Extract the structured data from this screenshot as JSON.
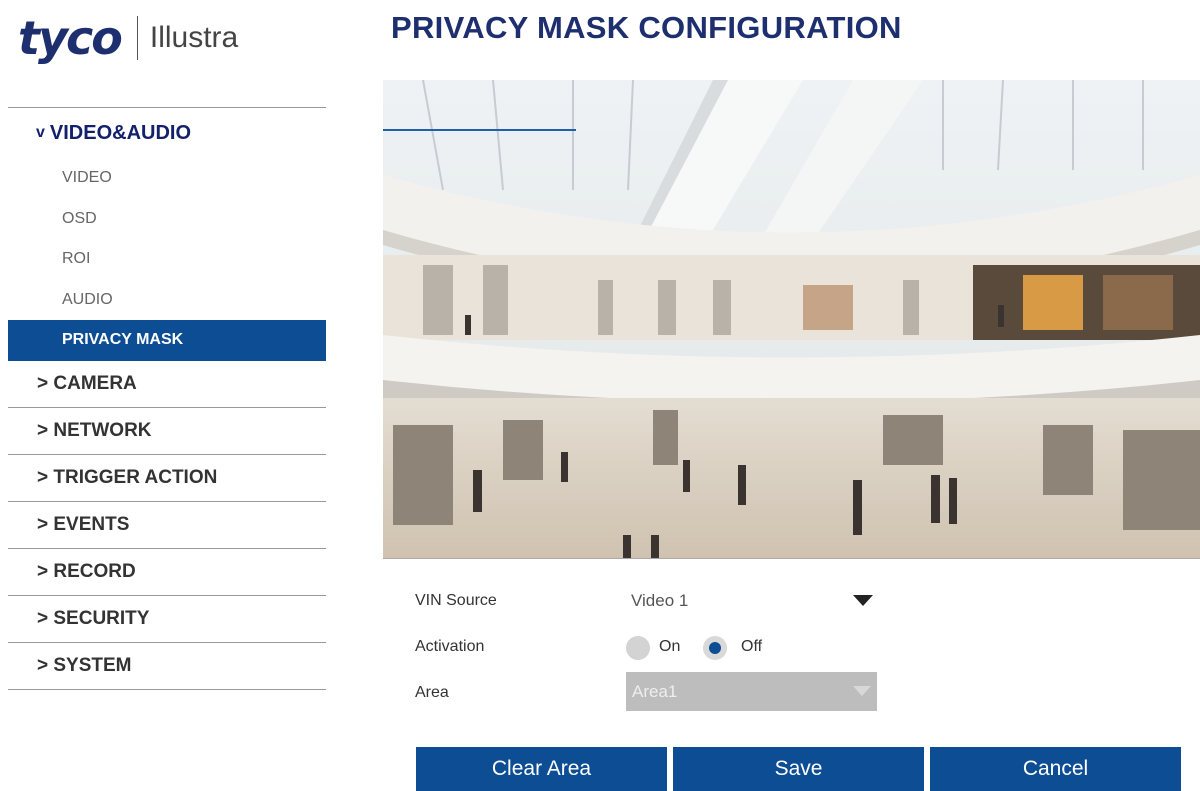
{
  "logo": {
    "brand": "tyco",
    "product": "Illustra"
  },
  "page": {
    "title": "PRIVACY MASK CONFIGURATION"
  },
  "sidebar": {
    "open_section": {
      "chevron": "v",
      "label": "VIDEO&AUDIO"
    },
    "sub_items": [
      {
        "label": "VIDEO",
        "active": false
      },
      {
        "label": "OSD",
        "active": false
      },
      {
        "label": "ROI",
        "active": false
      },
      {
        "label": "AUDIO",
        "active": false
      },
      {
        "label": "PRIVACY MASK",
        "active": true
      }
    ],
    "sections": [
      {
        "label": "> CAMERA"
      },
      {
        "label": "> NETWORK"
      },
      {
        "label": "> TRIGGER ACTION"
      },
      {
        "label": "> EVENTS"
      },
      {
        "label": "> RECORD"
      },
      {
        "label": "> SECURITY"
      },
      {
        "label": "> SYSTEM"
      }
    ]
  },
  "form": {
    "vin_source": {
      "label": "VIN Source",
      "value": "Video 1"
    },
    "activation": {
      "label": "Activation",
      "option_on": "On",
      "option_off": "Off",
      "selected": "Off"
    },
    "area": {
      "label": "Area",
      "value": "Area1",
      "disabled": true
    }
  },
  "buttons": {
    "clear_area": "Clear Area",
    "save": "Save",
    "cancel": "Cancel"
  },
  "colors": {
    "brand_navy": "#1d2f6e",
    "accent_blue": "#0d4d94",
    "nav_header": "#13206b",
    "disabled_gray": "#bdbdbd"
  }
}
